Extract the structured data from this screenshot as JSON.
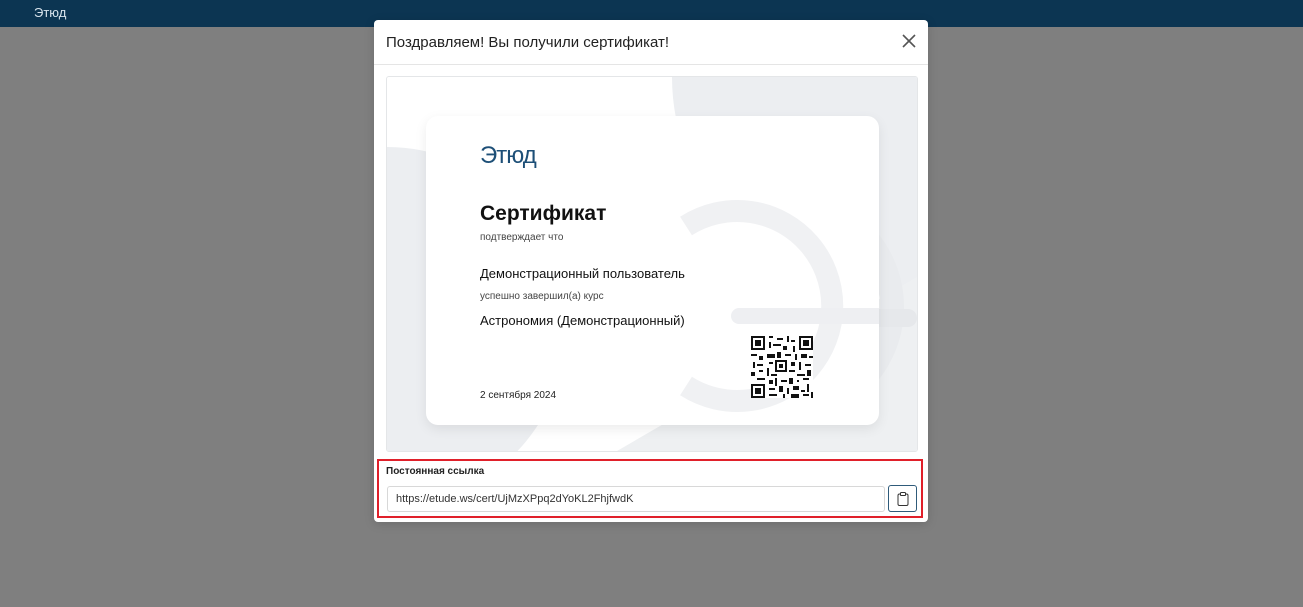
{
  "app": {
    "logo": "Этюд"
  },
  "modal": {
    "title": "Поздравляем! Вы получили сертификат!",
    "close_icon": "close-icon"
  },
  "certificate": {
    "logo": "Этюд",
    "title": "Сертификат",
    "confirms": "подтверждает что",
    "user": "Демонстрационный пользователь",
    "completed": "успешно завершил(а) курс",
    "course": "Астрономия (Демонстрационный)",
    "date": "2 сентября 2024"
  },
  "permalink": {
    "label": "Постоянная ссылка",
    "url": "https://etude.ws/cert/UjMzXPpq2dYoKL2FhjfwdK",
    "copy_icon": "clipboard-icon"
  },
  "colors": {
    "topbar": "#0c3552",
    "backdrop": "#7f7f7f",
    "highlight": "#e0202a",
    "accent": "#2f5b7a"
  }
}
